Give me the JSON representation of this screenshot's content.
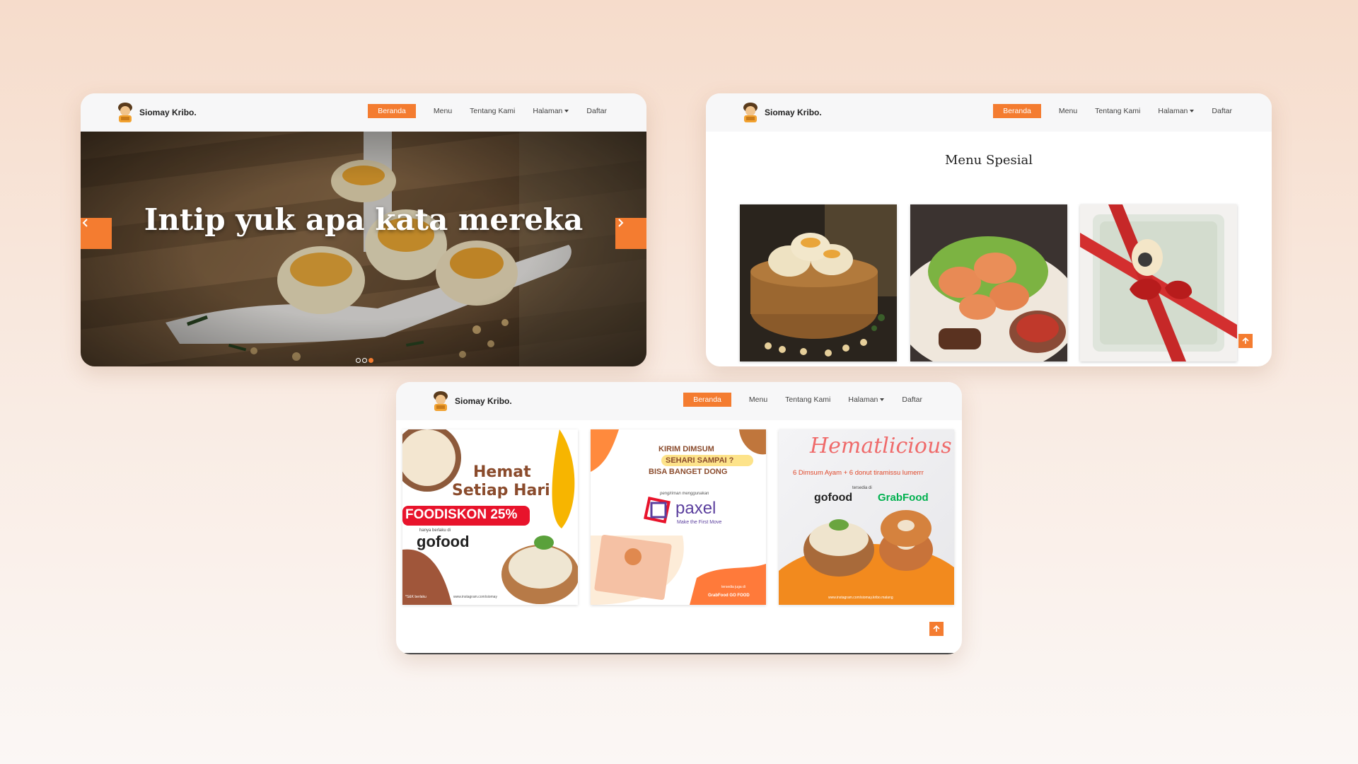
{
  "nav": {
    "brand": "Siomay Kribo.",
    "items": [
      "Beranda",
      "Menu",
      "Tentang Kami",
      "Halaman",
      "Daftar"
    ]
  },
  "hero": {
    "title": "Intip yuk apa kata mereka",
    "prev_icon": "chevron-left-icon",
    "next_icon": "chevron-right-icon",
    "slides": 3,
    "active_slide": 3
  },
  "menu_section": {
    "title": "Menu Spesial",
    "photos": [
      "siomay-bamboo-steamer-photo",
      "fried-siomay-photo",
      "gift-box-photo"
    ]
  },
  "promos": {
    "card1": {
      "title_line1": "Hemat",
      "title_line2": "Setiap Hari",
      "badge": "FOODISKON 25%",
      "note": "hanya berlaku di",
      "brand": "gofood",
      "tnc": "*S&K berlaku",
      "url": "www.instagram.com/siomay"
    },
    "card2": {
      "line1": "KIRIM DIMSUM",
      "line2": "SEHARI SAMPAI ?",
      "line3": "BISA BANGET DONG",
      "caption": "pengiriman menggunakan",
      "brand": "paxel",
      "tagline": "Make the First Move",
      "note": "tersedia juga di",
      "brands_small": "GrabFood  GO FOOD"
    },
    "card3": {
      "title": "Hematlicious",
      "subtitle": "6 Dimsum Ayam + 6 donut tiramissu lumerrr",
      "note": "tersedia di",
      "brand1": "gofood",
      "brand2": "GrabFood",
      "url": "www.instagram.com/siomay.kribo.malang"
    }
  },
  "colors": {
    "accent": "#f47c30",
    "navbar": "#f7f7f8",
    "gofood_red": "#e8132b",
    "grab_green": "#00b14f",
    "paxel_purple": "#5b3f9e"
  }
}
